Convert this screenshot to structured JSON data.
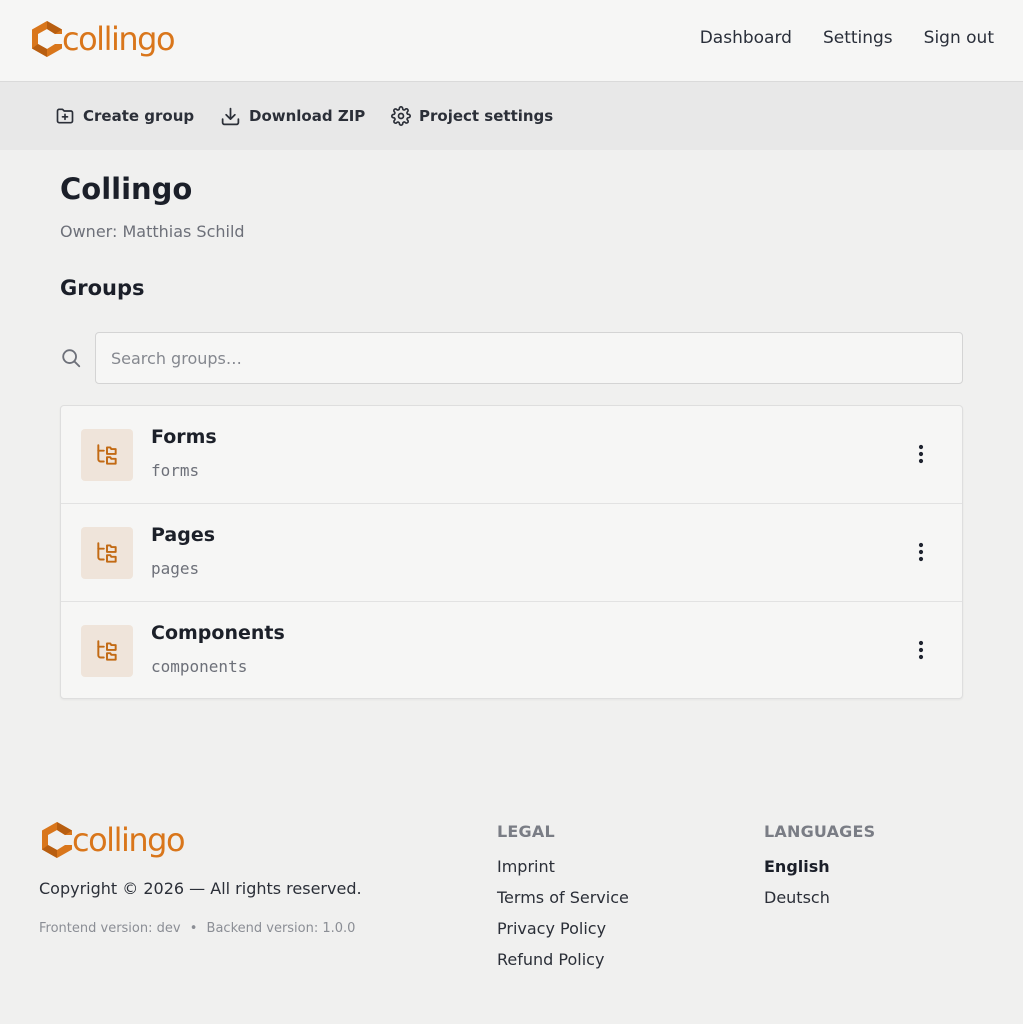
{
  "brand": {
    "name": "collingo",
    "color": "#d9761b"
  },
  "topnav": {
    "dashboard": "Dashboard",
    "settings": "Settings",
    "signout": "Sign out"
  },
  "toolbar": {
    "create_group": "Create group",
    "download_zip": "Download ZIP",
    "project_settings": "Project settings"
  },
  "project": {
    "title": "Collingo",
    "owner_label": "Owner:",
    "owner_name": "Matthias Schild"
  },
  "groups": {
    "heading": "Groups",
    "search_placeholder": "Search groups…",
    "items": [
      {
        "name": "Forms",
        "slug": "forms"
      },
      {
        "name": "Pages",
        "slug": "pages"
      },
      {
        "name": "Components",
        "slug": "components"
      }
    ]
  },
  "footer": {
    "copyright": "Copyright © 2026 — All rights reserved.",
    "frontend_version": "Frontend version: dev",
    "separator": "•",
    "backend_version": "Backend version: 1.0.0",
    "legal": {
      "heading": "LEGAL",
      "links": [
        "Imprint",
        "Terms of Service",
        "Privacy Policy",
        "Refund Policy"
      ]
    },
    "languages": {
      "heading": "LANGUAGES",
      "items": [
        "English",
        "Deutsch"
      ],
      "active": "English"
    }
  },
  "icons": {
    "logo": "collingo-logo-icon",
    "create_group": "folder-plus-icon",
    "download": "download-icon",
    "settings": "gear-icon",
    "search": "search-icon",
    "group": "folder-tree-icon",
    "menu": "kebab-menu-icon"
  }
}
